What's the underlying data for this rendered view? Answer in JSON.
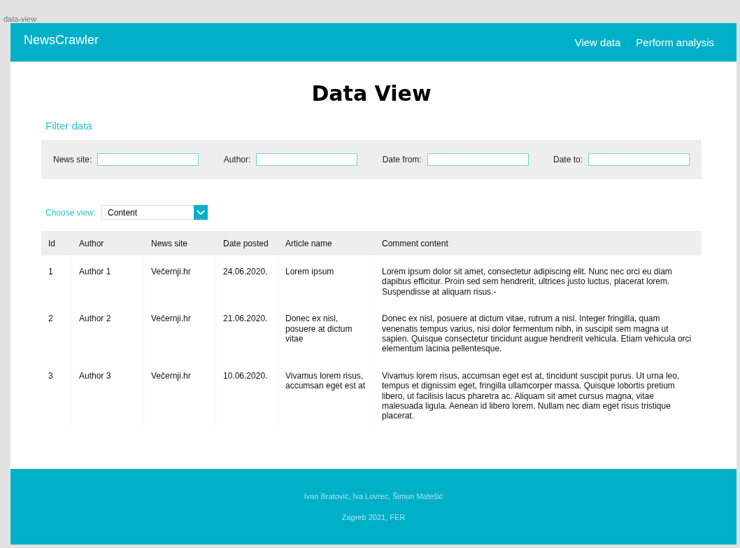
{
  "frame_label": "data-view",
  "header": {
    "brand": "NewsCrawler",
    "nav": [
      {
        "label": "View data"
      },
      {
        "label": "Perform analysis"
      }
    ]
  },
  "title": "Data View",
  "filter": {
    "heading": "Filter data",
    "fields": [
      {
        "label": "News site:"
      },
      {
        "label": "Author:"
      },
      {
        "label": "Date from:"
      },
      {
        "label": "Date to:"
      }
    ]
  },
  "view_select": {
    "label": "Choose view:",
    "value": "Content"
  },
  "table": {
    "columns": [
      "Id",
      "Author",
      "News site",
      "Date posted",
      "Article name",
      "Comment content"
    ],
    "rows": [
      [
        "1",
        "Author 1",
        "Večernji.hr",
        "24.06.2020.",
        "Lorem ipsum",
        "Lorem ipsum dolor sit amet, consectetur adipiscing elit. Nunc nec orci eu diam dapibus efficitur. Proin sed sem hendrerit, ultrices justo luctus, placerat lorem. Suspendisse at aliquam risus.-"
      ],
      [
        "2",
        "Author 2",
        "Večernji.hr",
        "21.06.2020.",
        "Donec ex nisl, posuere at dictum vitae",
        "Donec ex nisl, posuere at dictum vitae, rutrum a nisl. Integer fringilla, quam venenatis tempus varius, nisi dolor fermentum nibh, in suscipit sem magna ut sapien. Quisque consectetur tincidunt augue hendrerit vehicula. Etiam vehicula orci elementum lacinia pellentesque."
      ],
      [
        "3",
        "Author 3",
        "Večernji.hr",
        "10.06.2020.",
        "Vivamus lorem risus, accumsan eget est at",
        "Vivamus lorem risus, accumsan eget est at, tincidunt suscipit purus. Ut urna leo, tempus et dignissim eget, fringilla ullamcorper massa. Quisque lobortis pretium libero, ut facilisis lacus pharetra ac. Aliquam sit amet cursus magna, vitae malesuada ligula. Aenean id libero lorem. Nullam nec diam eget risus tristique placerat."
      ]
    ]
  },
  "footer": [
    "Ivan Bratović, Iva Lovrec, Šimun Matešić",
    "Zagreb 2021, FER"
  ]
}
